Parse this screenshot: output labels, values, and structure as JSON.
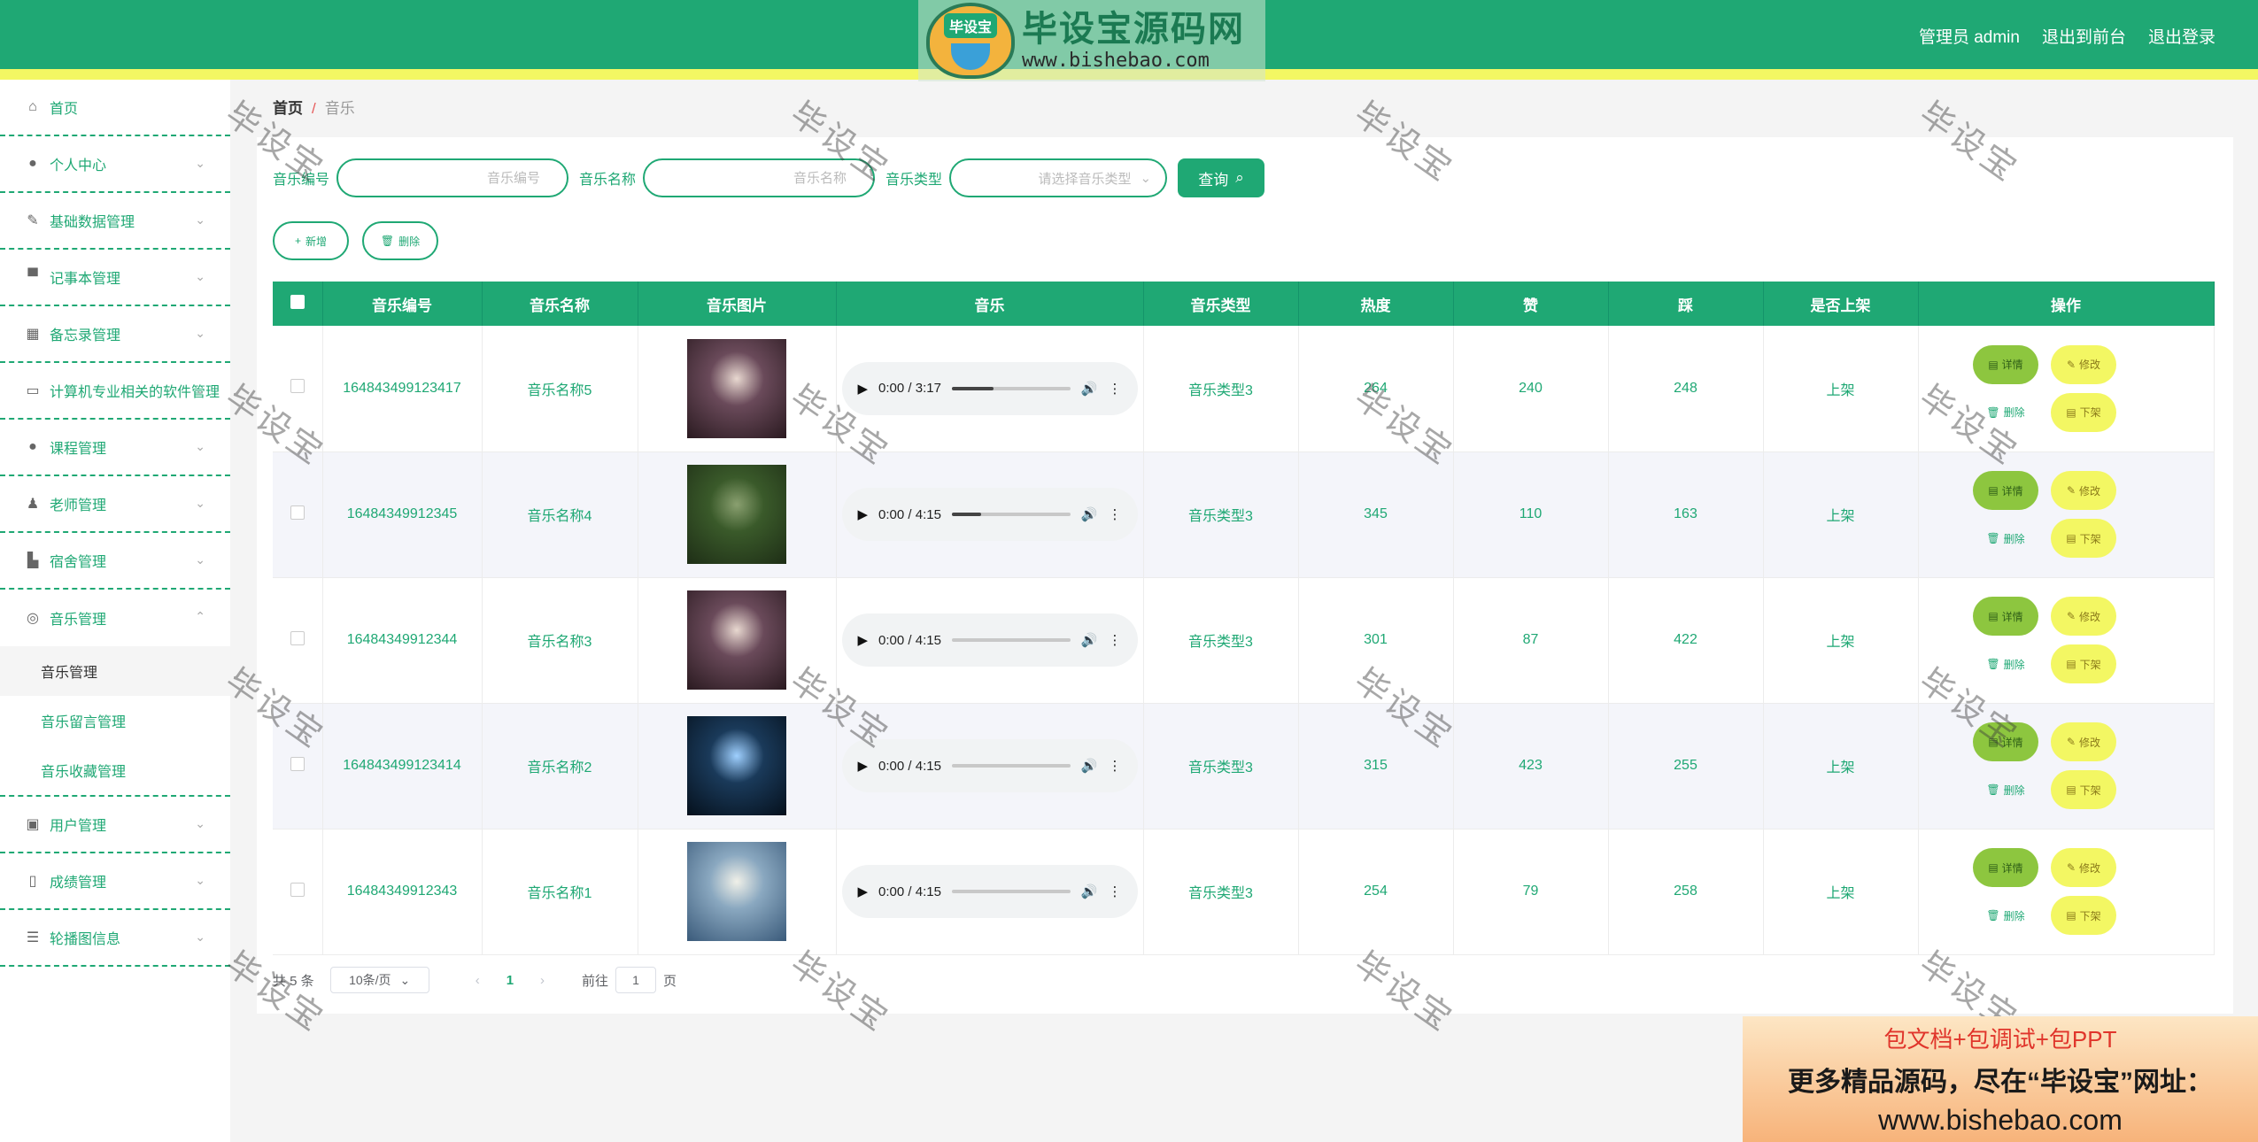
{
  "header": {
    "logo_cn": "毕设宝源码网",
    "logo_badge": "毕设宝",
    "logo_url": "www.bishebao.com",
    "links": [
      "管理员 admin",
      "退出到前台",
      "退出登录"
    ]
  },
  "sidebar": {
    "items": [
      {
        "label": "首页",
        "icon": "home-icon",
        "glyph": "⌂"
      },
      {
        "label": "个人中心",
        "icon": "user-icon",
        "glyph": "●"
      },
      {
        "label": "基础数据管理",
        "icon": "bell-off-icon",
        "glyph": "✎"
      },
      {
        "label": "记事本管理",
        "icon": "monitor-icon",
        "glyph": "▀"
      },
      {
        "label": "备忘录管理",
        "icon": "chart-icon",
        "glyph": "▦"
      },
      {
        "label": "计算机专业相关的软件管理",
        "icon": "chat-icon",
        "glyph": "▭"
      },
      {
        "label": "课程管理",
        "icon": "person-icon",
        "glyph": "●"
      },
      {
        "label": "老师管理",
        "icon": "teacher-icon",
        "glyph": "♟"
      },
      {
        "label": "宿舍管理",
        "icon": "thumb-icon",
        "glyph": "▙"
      },
      {
        "label": "音乐管理",
        "icon": "compass-icon",
        "glyph": "◎"
      }
    ],
    "music_sub": [
      "音乐管理",
      "音乐留言管理",
      "音乐收藏管理"
    ],
    "items_after": [
      {
        "label": "用户管理",
        "icon": "clipboard-icon",
        "glyph": "▣"
      },
      {
        "label": "成绩管理",
        "icon": "mic-icon",
        "glyph": "▯"
      },
      {
        "label": "轮播图信息",
        "icon": "sliders-icon",
        "glyph": "☰"
      }
    ]
  },
  "breadcrumb": {
    "home": "首页",
    "sep": "/",
    "current": "音乐"
  },
  "search": {
    "label_code": "音乐编号",
    "placeholder_code": "音乐编号",
    "label_name": "音乐名称",
    "placeholder_name": "音乐名称",
    "label_type": "音乐类型",
    "placeholder_type": "请选择音乐类型",
    "query_label": "查询"
  },
  "actions": {
    "add": "新增",
    "delete": "删除"
  },
  "table": {
    "headers": [
      "音乐编号",
      "音乐名称",
      "音乐图片",
      "音乐",
      "音乐类型",
      "热度",
      "赞",
      "踩",
      "是否上架",
      "操作"
    ],
    "op_labels": {
      "detail": "详情",
      "edit": "修改",
      "delete": "删除",
      "down": "下架"
    },
    "rows": [
      {
        "code": "164843499123417",
        "name": "音乐名称5",
        "time": "0:00 / 3:17",
        "progress": 0.35,
        "type": "音乐类型3",
        "heat": "264",
        "like": "240",
        "dislike": "248",
        "status": "上架",
        "cover": [
          "#6a4a5a",
          "#2a1a20",
          "#e8d8d0"
        ]
      },
      {
        "code": "16484349912345",
        "name": "音乐名称4",
        "time": "0:00 / 4:15",
        "progress": 0.25,
        "type": "音乐类型3",
        "heat": "345",
        "like": "110",
        "dislike": "163",
        "status": "上架",
        "cover": [
          "#3a5a2a",
          "#1e2e16",
          "#8aa070"
        ]
      },
      {
        "code": "16484349912344",
        "name": "音乐名称3",
        "time": "0:00 / 4:15",
        "progress": 0,
        "type": "音乐类型3",
        "heat": "301",
        "like": "87",
        "dislike": "422",
        "status": "上架",
        "cover": [
          "#6a4a5a",
          "#2a1a20",
          "#e8d8d0"
        ]
      },
      {
        "code": "164843499123414",
        "name": "音乐名称2",
        "time": "0:00 / 4:15",
        "progress": 0,
        "type": "音乐类型3",
        "heat": "315",
        "like": "423",
        "dislike": "255",
        "status": "上架",
        "cover": [
          "#1a3a5a",
          "#05101c",
          "#9fd0ff"
        ]
      },
      {
        "code": "16484349912343",
        "name": "音乐名称1",
        "time": "0:00 / 4:15",
        "progress": 0,
        "type": "音乐类型3",
        "heat": "254",
        "like": "79",
        "dislike": "258",
        "status": "上架",
        "cover": [
          "#8aa8c0",
          "#3a5a7a",
          "#f0f0e8"
        ]
      }
    ]
  },
  "pager": {
    "total": "共 5 条",
    "size": "10条/页",
    "page": "1",
    "goto_prefix": "前往",
    "goto_value": "1",
    "goto_suffix": "页"
  },
  "watermark": "毕设宝",
  "ad": {
    "line1": "包文档+包调试+包PPT",
    "line2": "更多精品源码，尽在“毕设宝”网址：",
    "line3": "www.bishebao.com"
  },
  "colors": {
    "primary": "#1fa874",
    "accent_yellow": "#f3f763",
    "detail_green": "#8dc63f",
    "delete_dark": "#2e6d16"
  }
}
